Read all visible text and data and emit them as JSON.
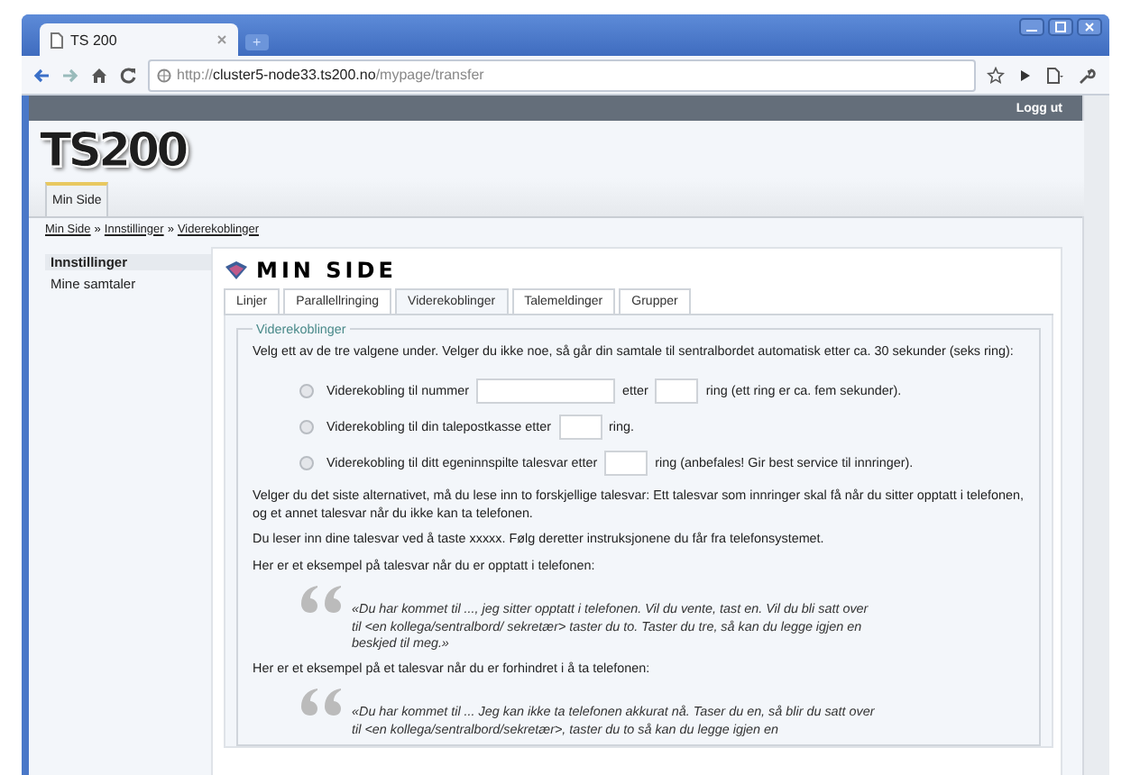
{
  "browser": {
    "tab_title": "TS 200",
    "new_tab": "+",
    "url": {
      "scheme": "http://",
      "host": "cluster5-node33.ts200.no",
      "path": "/mypage/transfer"
    }
  },
  "topbar": {
    "logout": "Logg ut"
  },
  "logo": "TS200",
  "top_tabs": [
    {
      "label": "Min Side",
      "selected": true
    }
  ],
  "breadcrumb": {
    "items": [
      "Min Side",
      "Innstillinger",
      "Viderekoblinger"
    ],
    "separator": "»"
  },
  "sidebar": {
    "items": [
      {
        "label": "Innstillinger",
        "selected": true
      },
      {
        "label": "Mine samtaler",
        "selected": false
      }
    ]
  },
  "heading": "MIN SIDE",
  "tabs": [
    {
      "label": "Linjer",
      "selected": false
    },
    {
      "label": "Parallellringing",
      "selected": false
    },
    {
      "label": "Viderekoblinger",
      "selected": true
    },
    {
      "label": "Talemeldinger",
      "selected": false
    },
    {
      "label": "Grupper",
      "selected": false
    }
  ],
  "fieldset": {
    "legend": "Viderekoblinger",
    "intro": "Velg ett av de tre valgene under. Velger du ikke noe, så går din samtale til sentralbordet automatisk etter ca. 30 sekunder (seks ring):",
    "options": [
      {
        "selected": false,
        "parts": [
          {
            "kind": "text",
            "text": "Viderekobling til nummer"
          },
          {
            "kind": "wide_field"
          },
          {
            "kind": "text",
            "text": "etter"
          },
          {
            "kind": "short_field"
          },
          {
            "kind": "text",
            "text": "ring (ett ring er ca. fem sekunder)."
          }
        ]
      },
      {
        "selected": false,
        "parts": [
          {
            "kind": "text",
            "text": "Viderekobling til din talepostkasse etter"
          },
          {
            "kind": "short_field"
          },
          {
            "kind": "text",
            "text": "ring."
          }
        ]
      },
      {
        "selected": false,
        "parts": [
          {
            "kind": "text",
            "text": "Viderekobling til ditt egeninnspilte talesvar etter"
          },
          {
            "kind": "short_field"
          },
          {
            "kind": "text",
            "text": "ring (anbefales! Gir best service til innringer)."
          }
        ]
      }
    ],
    "content": [
      {
        "kind": "paragraph",
        "text": "Velger du det siste alternativet, må du lese inn to forskjellige talesvar: Ett talesvar som innringer skal få når du sitter opptatt i telefonen, og et annet talesvar når du ikke kan ta telefonen."
      },
      {
        "kind": "paragraph",
        "text": "Du leser inn dine talesvar ved å taste xxxxx. Følg deretter instruksjonene du får fra telefonsystemet."
      },
      {
        "kind": "paragraph",
        "text": "Her er et eksempel på talesvar når du er opptatt i telefonen:"
      },
      {
        "kind": "quote",
        "text": "«Du har kommet til ..., jeg sitter opptatt i telefonen. Vil du vente, tast en. Vil du bli satt over til <en kollega/sentralbord/ sekretær> taster du to. Taster du tre, så kan du legge igjen en beskjed til meg.»"
      },
      {
        "kind": "paragraph",
        "text": "Her er et eksempel på et talesvar når du er forhindret i å ta telefonen:"
      },
      {
        "kind": "quote",
        "text": "«Du har kommet til ... Jeg kan ikke ta telefonen akkurat nå. Taser du en, så blir du satt over til <en kollega/sentralbord/sekretær>, taster du to så kan du legge igjen en"
      }
    ]
  }
}
